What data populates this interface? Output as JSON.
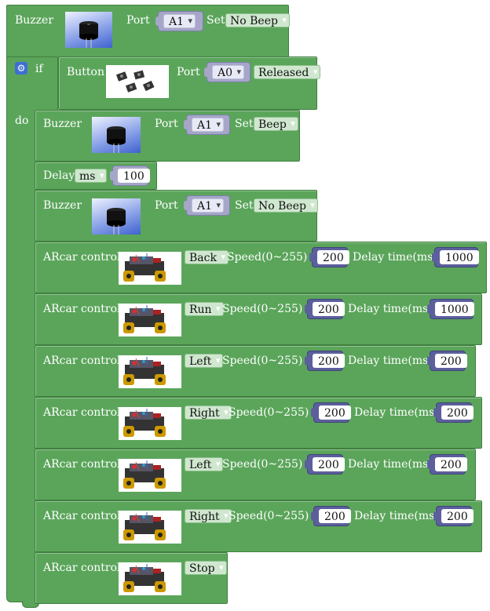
{
  "buzzer_top": {
    "label": "Buzzer",
    "port_label": "Port",
    "port": "A1",
    "set_label": "Set",
    "state": "No Beep"
  },
  "if_block": {
    "if_label": "if",
    "do_label": "do",
    "gear_icon": "gear-icon"
  },
  "button_block": {
    "label": "Button",
    "port_label": "Port",
    "port": "A0",
    "state": "Released"
  },
  "buzzer_beep": {
    "label": "Buzzer",
    "port_label": "Port",
    "port": "A1",
    "set_label": "Set",
    "state": "Beep"
  },
  "delay": {
    "label": "Delay",
    "unit": "ms",
    "value": "100"
  },
  "buzzer_nobeep": {
    "label": "Buzzer",
    "port_label": "Port",
    "port": "A1",
    "set_label": "Set",
    "state": "No Beep"
  },
  "arcar": [
    {
      "label": "ARcar control",
      "dir": "Back",
      "speed_label": "Speed(0~255)",
      "speed": "200",
      "delay_label": "Delay time(ms)",
      "delay": "1000"
    },
    {
      "label": "ARcar control",
      "dir": "Run",
      "speed_label": "Speed(0~255)",
      "speed": "200",
      "delay_label": "Delay time(ms)",
      "delay": "1000"
    },
    {
      "label": "ARcar control",
      "dir": "Left",
      "speed_label": "Speed(0~255)",
      "speed": "200",
      "delay_label": "Delay time(ms)",
      "delay": "200"
    },
    {
      "label": "ARcar control",
      "dir": "Right",
      "speed_label": "Speed(0~255)",
      "speed": "200",
      "delay_label": "Delay time(ms)",
      "delay": "200"
    },
    {
      "label": "ARcar control",
      "dir": "Left",
      "speed_label": "Speed(0~255)",
      "speed": "200",
      "delay_label": "Delay time(ms)",
      "delay": "200"
    },
    {
      "label": "ARcar control",
      "dir": "Right",
      "speed_label": "Speed(0~255)",
      "speed": "200",
      "delay_label": "Delay time(ms)",
      "delay": "200"
    },
    {
      "label": "ARcar control",
      "dir": "Stop"
    }
  ],
  "colors": {
    "block": "#5ba55b",
    "block_border": "#3f7f3f",
    "dropdown": "#cfe7cf",
    "port_socket": "#a5a6c8",
    "number_socket": "#5b5f9c"
  }
}
